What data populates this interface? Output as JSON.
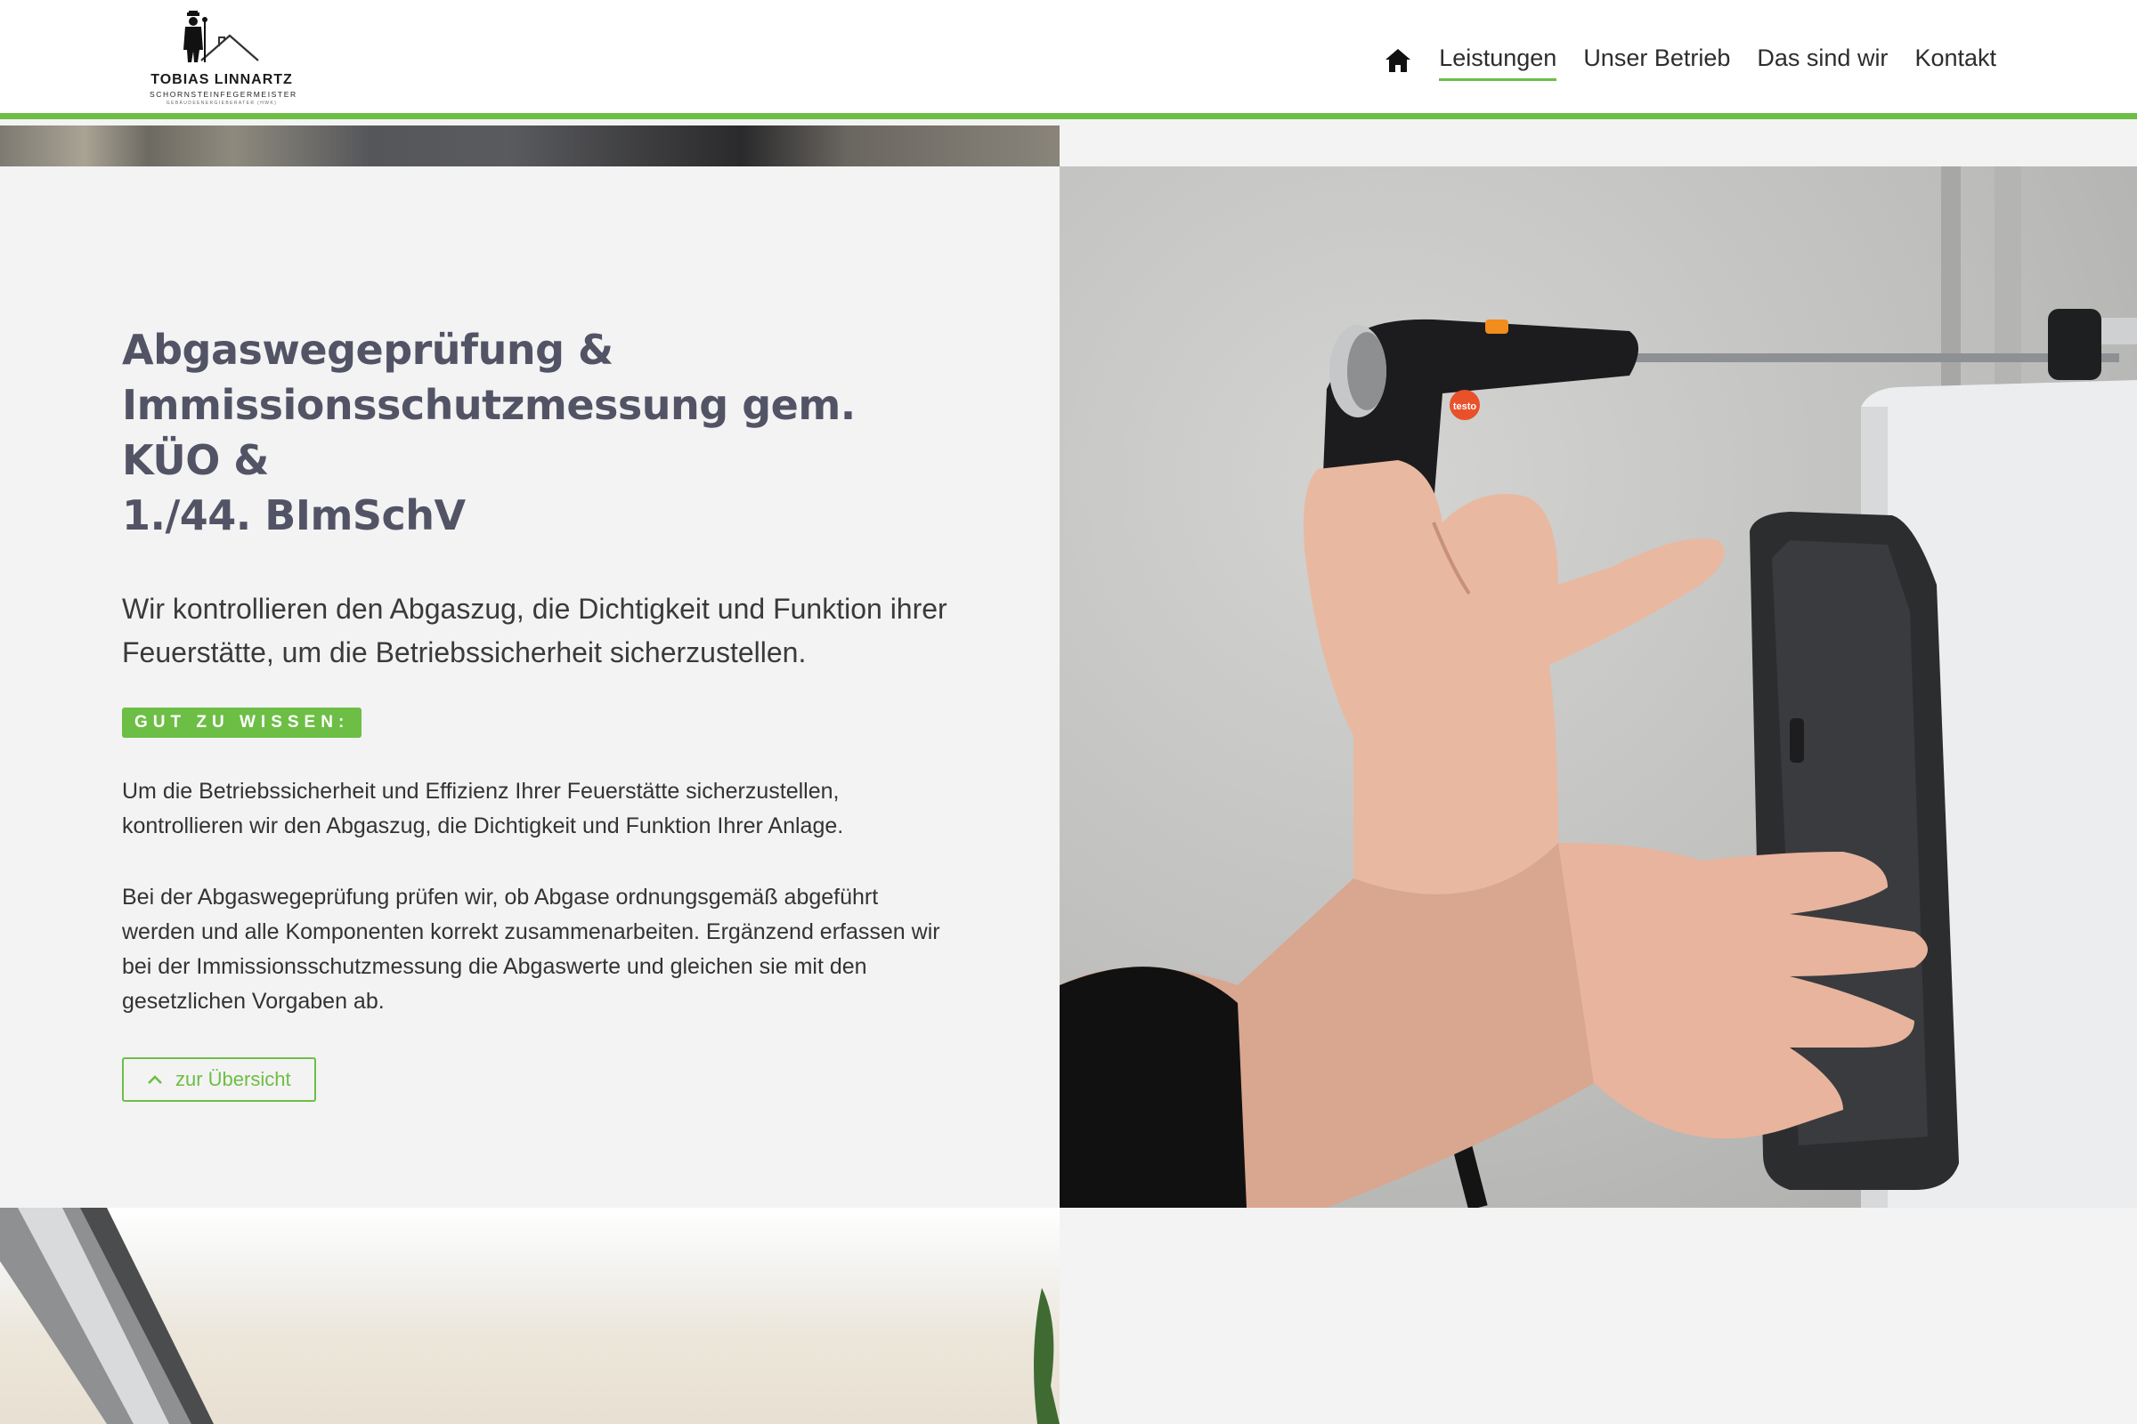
{
  "header": {
    "logo": {
      "name": "TOBIAS LINNARTZ",
      "subtitle": "SCHORNSTEINFEGERMEISTER",
      "subtitle2": "GEBÄUDEENERGIEBERATER (HWK)"
    },
    "nav": {
      "home_icon": "home-icon",
      "items": [
        {
          "label": "Leistungen",
          "active": true
        },
        {
          "label": "Unser Betrieb",
          "active": false
        },
        {
          "label": "Das sind wir",
          "active": false
        },
        {
          "label": "Kontakt",
          "active": false
        }
      ]
    }
  },
  "main": {
    "headline": "Abgaswegeprüfung &\nImmissionsschutzmessung gem. KÜO &\n1./44. BImSchV",
    "lead": "Wir kontrollieren den Abgaszug, die Dichtigkeit und Funktion ihrer Feuerstätte, um die Betriebssicherheit sicherzustellen.",
    "badge": "GUT ZU WISSEN:",
    "paragraph1": "Um die Betriebssicherheit und Effizienz Ihrer Feuerstätte sicherzustellen, kontrollieren wir den Abgaszug, die Dichtigkeit und Funktion Ihrer Anlage.",
    "paragraph2": "Bei der Abgaswegeprüfung prüfen wir, ob Abgase ordnungsgemäß abgeführt werden und alle Komponenten korrekt zusammenarbeiten. Ergänzend erfassen wir bei der Immissionsschutzmessung die Abgaswerte und gleichen sie mit den gesetzlichen Vorgaben ab.",
    "overview_button": "zur Übersicht"
  },
  "photo": {
    "device_label": "testo"
  },
  "colors": {
    "accent": "#6dbe45",
    "headline": "#525466",
    "panel_bg": "#f3f3f3"
  }
}
